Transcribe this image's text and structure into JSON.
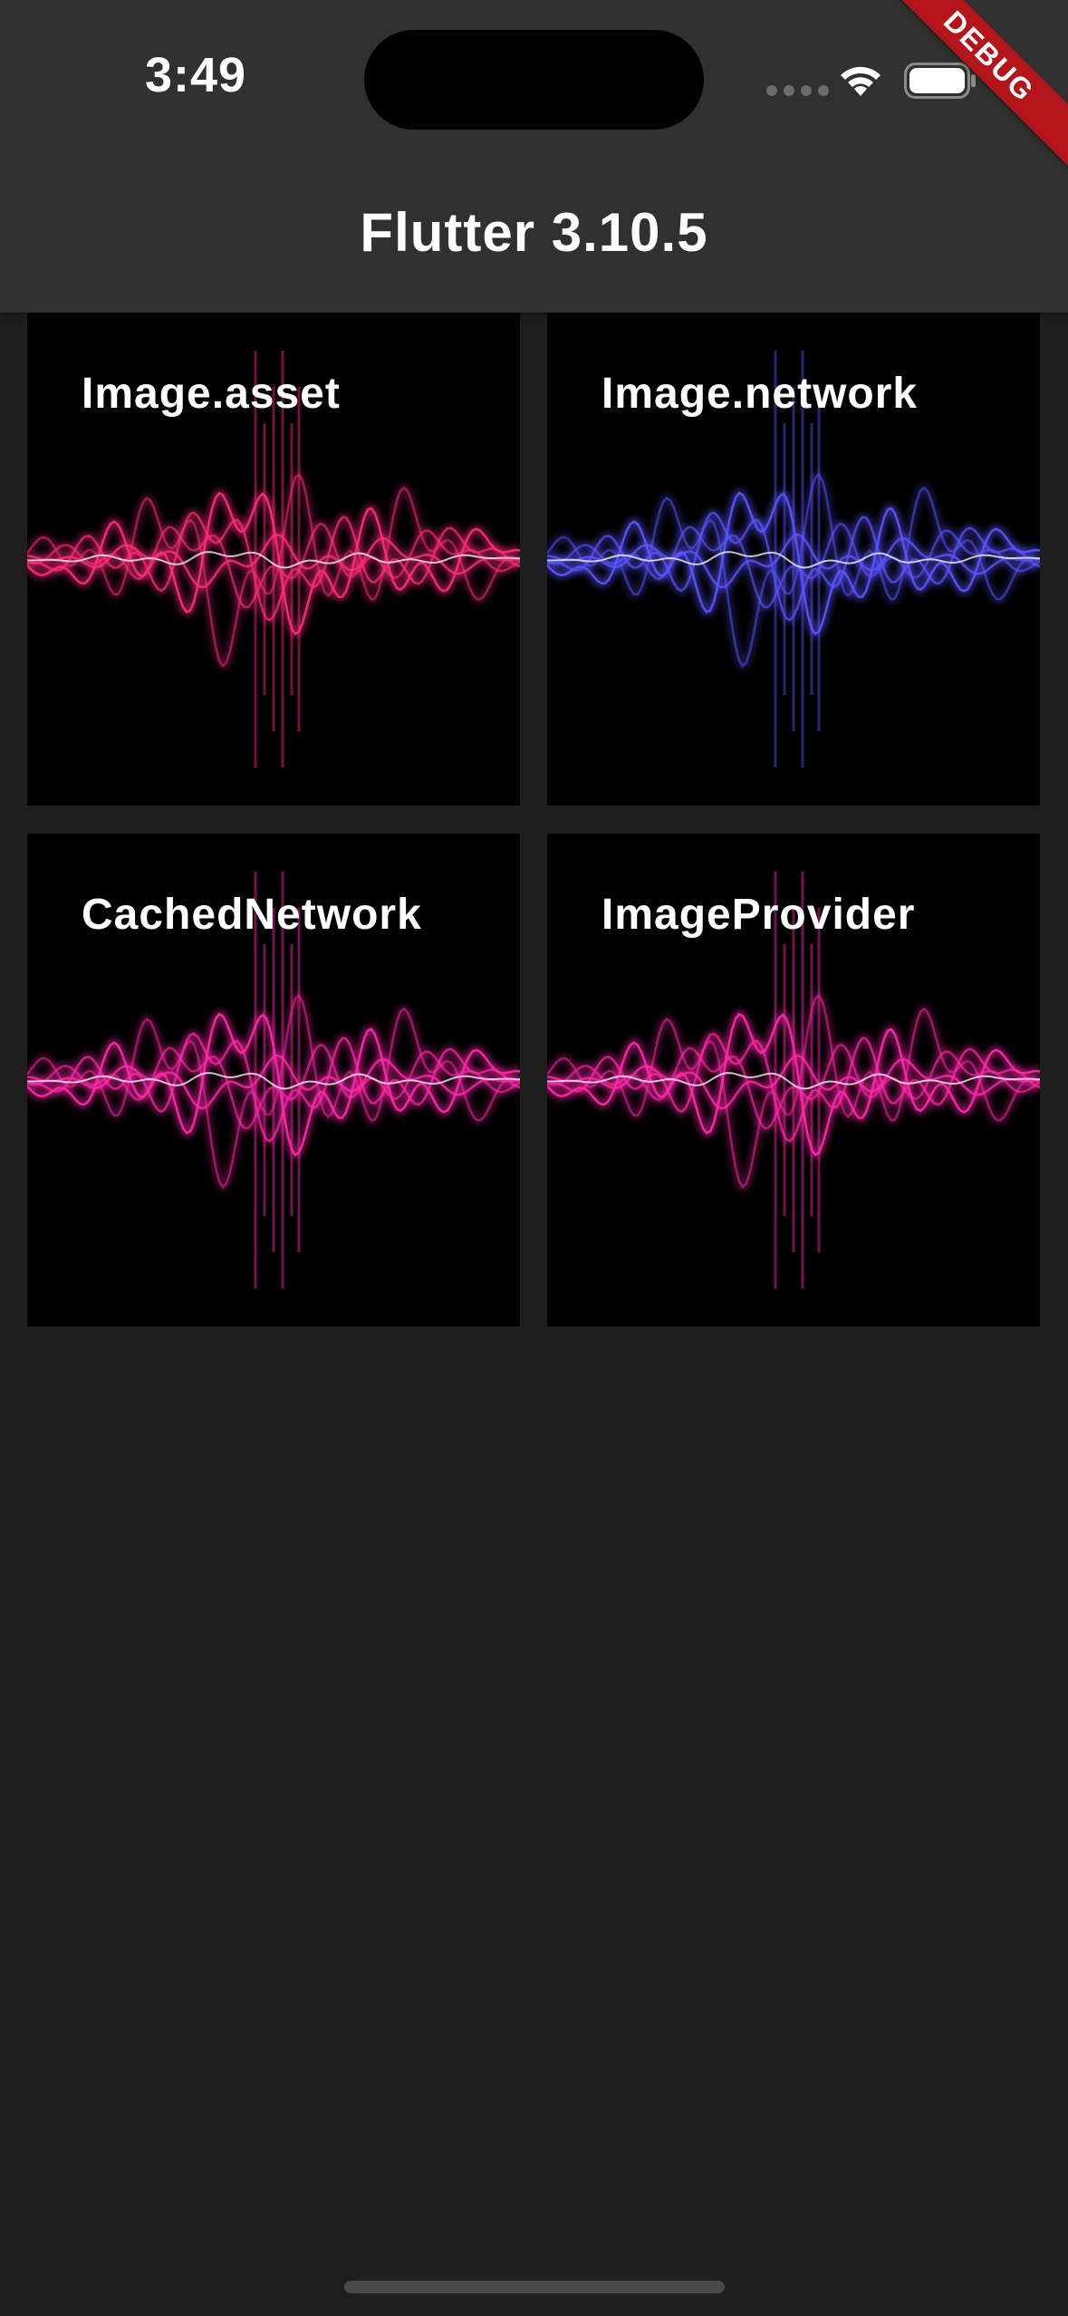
{
  "status_bar": {
    "time": "3:49"
  },
  "debug_banner": "DEBUG",
  "app_bar": {
    "title": "Flutter 3.10.5"
  },
  "tiles": [
    {
      "label": "Image.asset",
      "color": "#ff2e7a"
    },
    {
      "label": "Image.network",
      "color": "#5b55ff"
    },
    {
      "label": "CachedNetwork",
      "color": "#ff2aa8"
    },
    {
      "label": "ImageProvider",
      "color": "#ff2aa8"
    }
  ],
  "colors": {
    "background": "#1e1e1e",
    "app_bar": "#303030",
    "tile_background": "#000000",
    "debug_banner": "#b3151b"
  }
}
